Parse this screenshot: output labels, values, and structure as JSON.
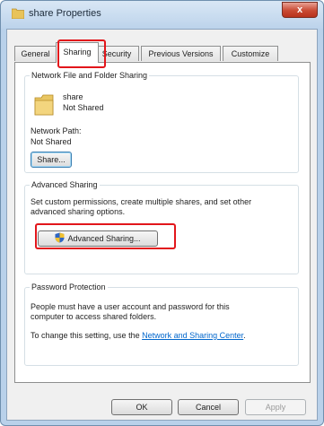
{
  "window": {
    "title": "share Properties",
    "close_glyph": "x"
  },
  "tabs": [
    {
      "label": "General"
    },
    {
      "label": "Sharing"
    },
    {
      "label": "Security"
    },
    {
      "label": "Previous Versions"
    },
    {
      "label": "Customize"
    }
  ],
  "network_sharing": {
    "group_title": "Network File and Folder Sharing",
    "folder_name": "share",
    "folder_status": "Not Shared",
    "path_label": "Network Path:",
    "path_value": "Not Shared",
    "share_button": "Share..."
  },
  "advanced_sharing": {
    "group_title": "Advanced Sharing",
    "description_line1": "Set custom permissions, create multiple shares, and set other",
    "description_line2": "advanced sharing options.",
    "button": "Advanced Sharing..."
  },
  "password_protection": {
    "group_title": "Password Protection",
    "line1": "People must have a user account and password for this",
    "line2": "computer to access shared folders.",
    "change_prefix": "To change this setting, use the",
    "link_text": "Network and Sharing Center",
    "link_suffix": "."
  },
  "footer": {
    "ok": "OK",
    "cancel": "Cancel",
    "apply": "Apply"
  },
  "colors": {
    "highlight_red": "#e2161b",
    "link_blue": "#0066cc"
  },
  "icons": {
    "title": "folder-icon",
    "folder": "folder-icon",
    "advanced_button": "uac-shield-icon",
    "close": "close-icon"
  }
}
